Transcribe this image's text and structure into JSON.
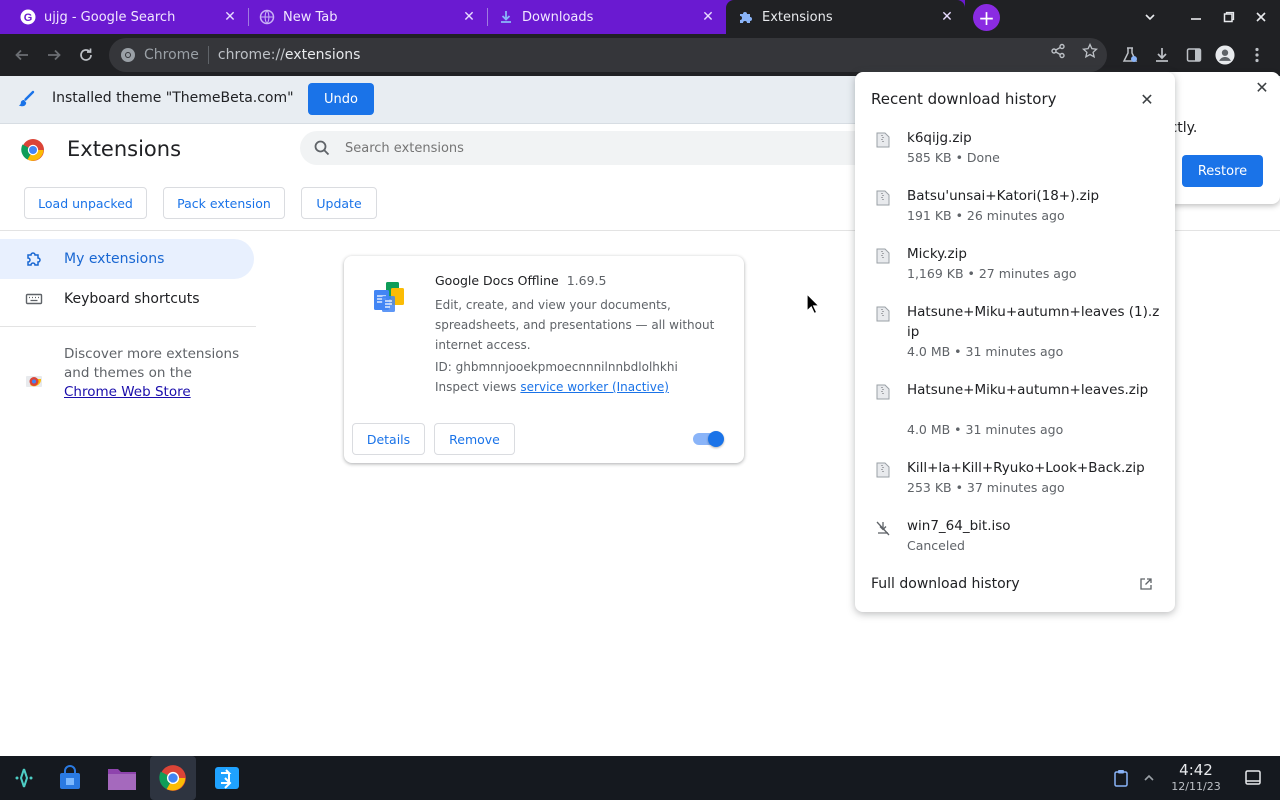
{
  "tabs": [
    {
      "title": "ujjg - Google Search",
      "icon": "google-icon",
      "close": "✕"
    },
    {
      "title": "New Tab",
      "icon": "globe-icon",
      "close": "✕"
    },
    {
      "title": "Downloads",
      "icon": "download-icon",
      "close": "✕"
    },
    {
      "title": "Extensions",
      "icon": "puzzle-icon",
      "close": "✕"
    }
  ],
  "window_controls": {
    "tabs_menu": "⌄",
    "minimize": "—",
    "restore": "❐",
    "close": "✕"
  },
  "omnibox": {
    "site": "Chrome",
    "url_scheme": "chrome://",
    "url_host": "extensions"
  },
  "infobar": {
    "message": "Installed theme \"ThemeBeta.com\"",
    "undo_label": "Undo"
  },
  "header": {
    "title": "Extensions",
    "search_placeholder": "Search extensions",
    "buttons": {
      "load_unpacked": "Load unpacked",
      "pack_extension": "Pack extension",
      "update": "Update"
    }
  },
  "sidebar": {
    "items": [
      {
        "label": "My extensions",
        "icon": "extensions-icon"
      },
      {
        "label": "Keyboard shortcuts",
        "icon": "keyboard-icon"
      }
    ],
    "discover_text": "Discover more extensions and themes on the ",
    "store_link": "Chrome Web Store"
  },
  "extension": {
    "name": "Google Docs Offline",
    "version": "1.69.5",
    "description": "Edit, create, and view your documents, spreadsheets, and presentations — all without internet access.",
    "id_line": "ID: ghbmnnjooekpmoecnnnilnnbdlolhkhi",
    "inspect_label": "Inspect views",
    "inspect_link": "service worker (Inactive)",
    "details_label": "Details",
    "remove_label": "Remove",
    "enabled": true
  },
  "back_popup": {
    "text": "rrectly.",
    "restore_label": "Restore",
    "close": "✕"
  },
  "downloads": {
    "title": "Recent download history",
    "close": "✕",
    "items": [
      {
        "name": "k6qijg.zip",
        "status": "585 KB • Done"
      },
      {
        "name": "Batsu'unsai+Katori(18+).zip",
        "status": "191 KB • 26 minutes ago"
      },
      {
        "name": "Micky.zip",
        "status": "1,169 KB • 27 minutes ago"
      },
      {
        "name": "Hatsune+Miku+autumn+leaves (1).zip",
        "status": "4.0 MB • 31 minutes ago"
      },
      {
        "name": "Hatsune+Miku+autumn+leaves.zip",
        "status": "4.0 MB • 31 minutes ago"
      },
      {
        "name": "Kill+la+Kill+Ryuko+Look+Back.zip",
        "status": "253 KB • 37 minutes ago"
      },
      {
        "name": "win7_64_bit.iso",
        "status": "Canceled"
      }
    ],
    "footer": "Full download history"
  },
  "shelf": {
    "time": "4:42",
    "date": "12/11/23"
  },
  "colors": {
    "accent": "#1a73e8",
    "tab_strip": "#6a1ad1",
    "toolbar": "#202124"
  }
}
